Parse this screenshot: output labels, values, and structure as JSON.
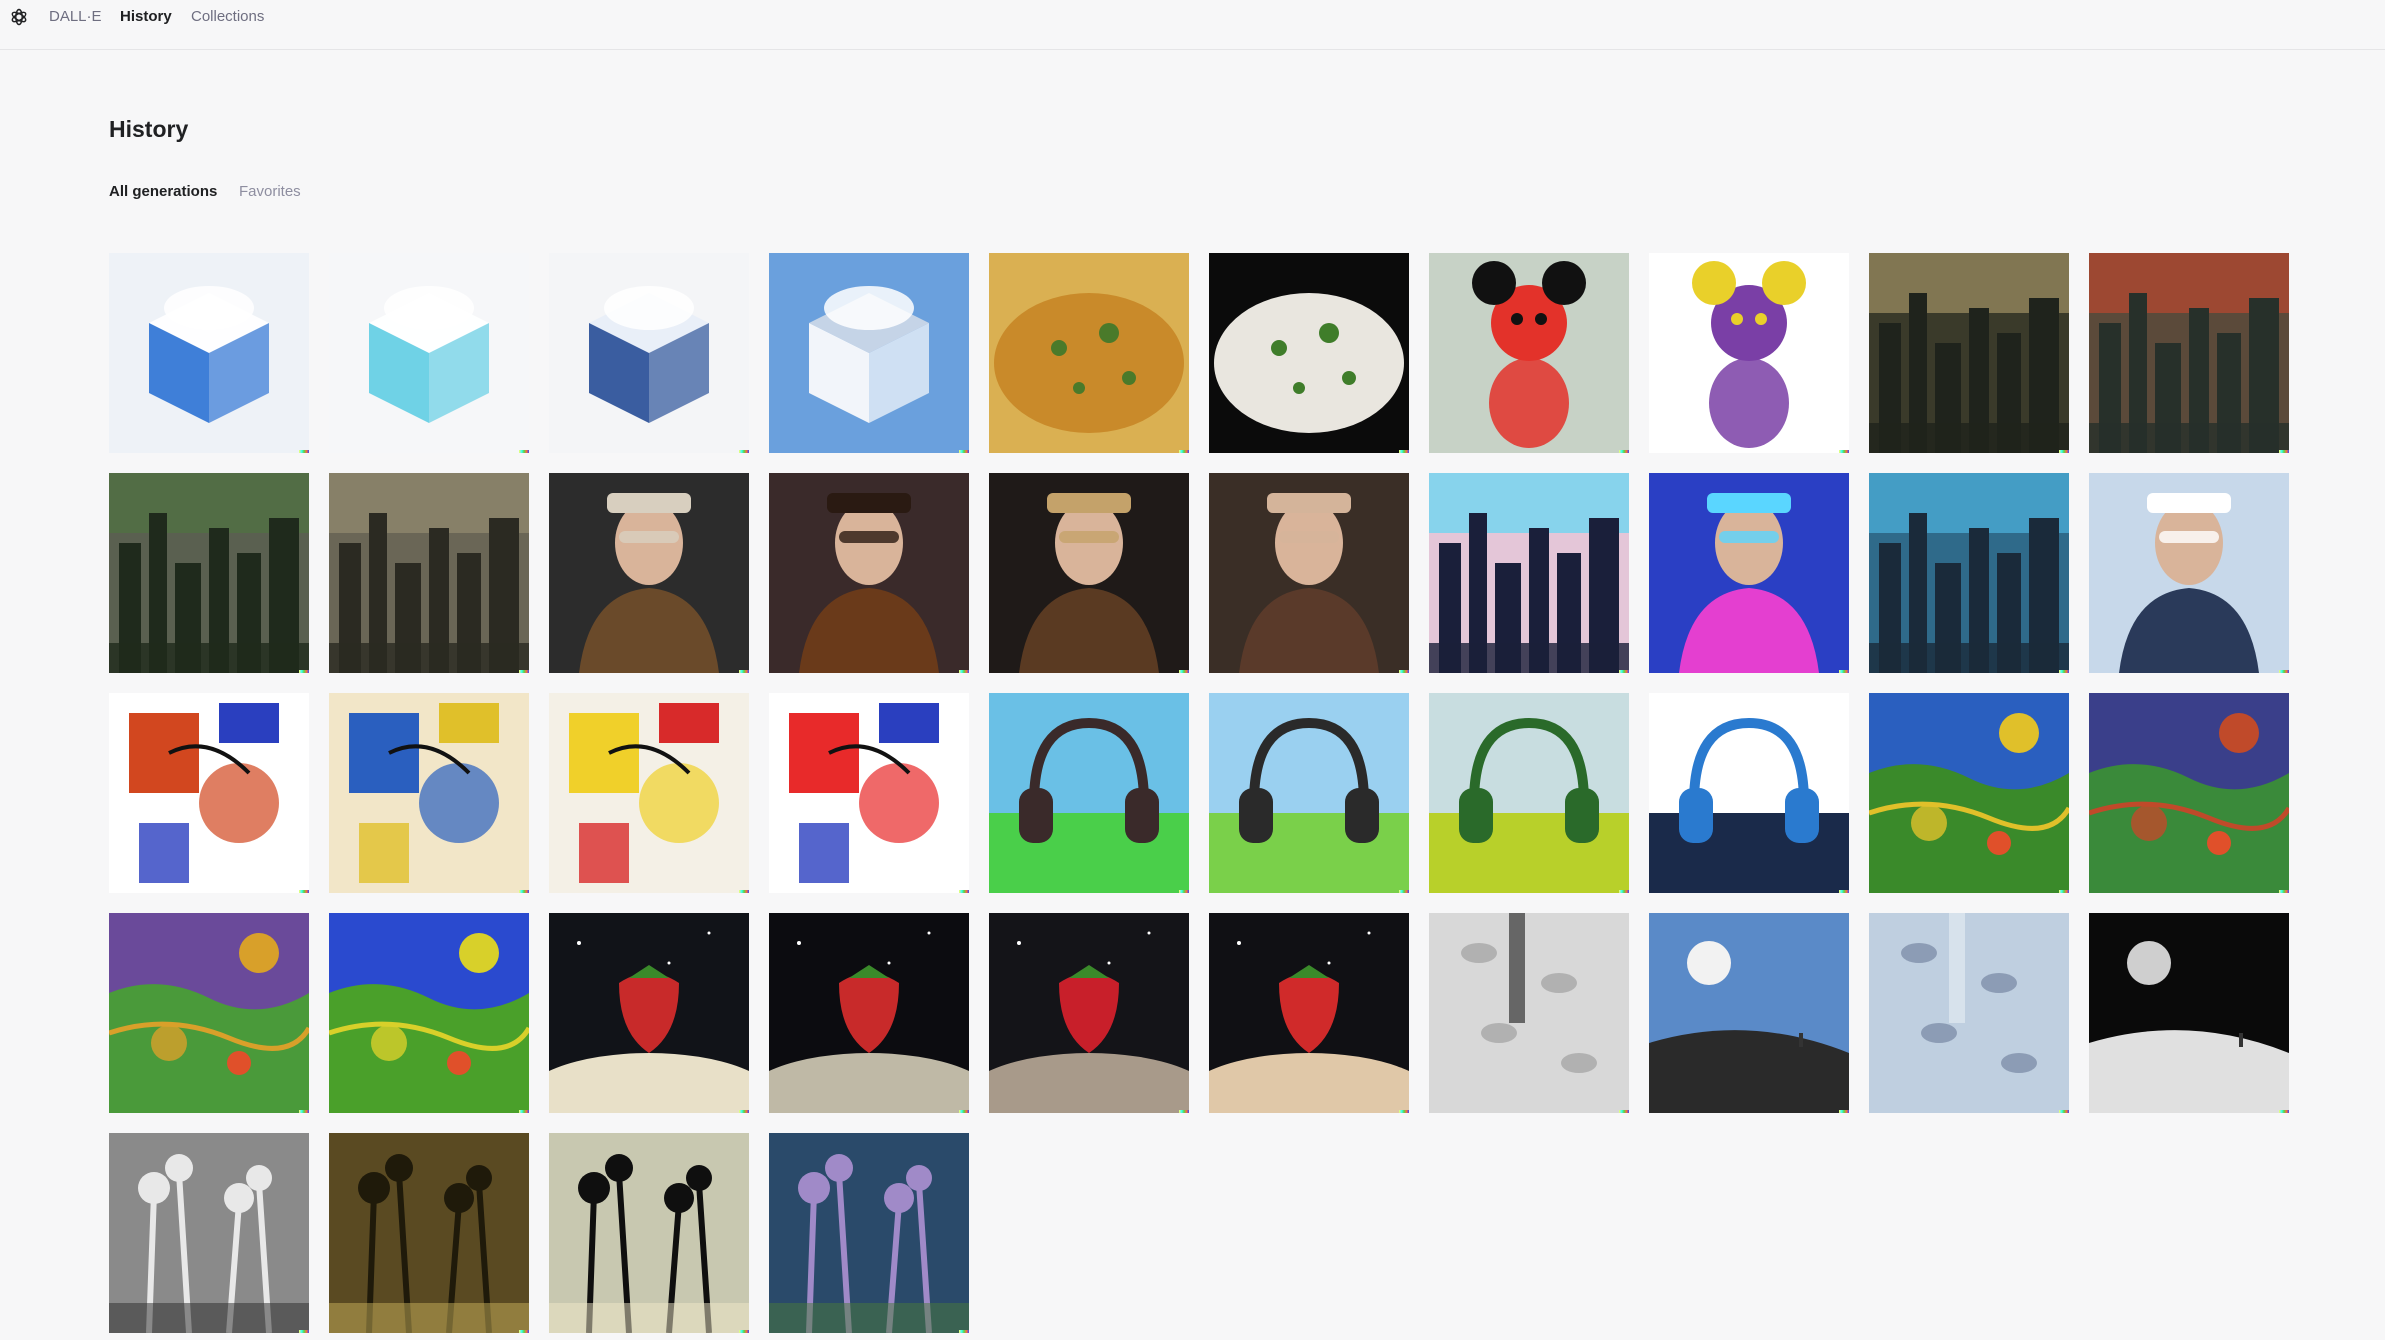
{
  "app": {
    "logo_icon": "openai-logo-icon",
    "nav": [
      {
        "label": "DALL·E",
        "active": false
      },
      {
        "label": "History",
        "active": true
      },
      {
        "label": "Collections",
        "active": false
      }
    ]
  },
  "page": {
    "title": "History",
    "tabs": [
      {
        "label": "All generations",
        "active": true
      },
      {
        "label": "Favorites",
        "active": false
      }
    ]
  },
  "images": [
    {
      "subject": "cloud-in-glass-cube",
      "bg": "#eef2f7",
      "fg": "#3f7fd8",
      "accent": "#ffffff",
      "shape": "cube"
    },
    {
      "subject": "cloud-cube-cyan",
      "bg": "#f6f7f9",
      "fg": "#6fd2e6",
      "accent": "#ffffff",
      "shape": "cube"
    },
    {
      "subject": "cube-with-clouds",
      "bg": "#f4f5f7",
      "fg": "#3a5da0",
      "accent": "#e8eef7",
      "shape": "cube"
    },
    {
      "subject": "white-cloud-cube-sky",
      "bg": "#6aa0dd",
      "fg": "#f2f5fa",
      "accent": "#cfd9e8",
      "shape": "cube"
    },
    {
      "subject": "soup-bowl",
      "bg": "#dab052",
      "fg": "#c98a2a",
      "accent": "#4a7a2a",
      "shape": "food"
    },
    {
      "subject": "dish-with-herbs",
      "bg": "#0b0b0b",
      "fg": "#e9e6df",
      "accent": "#3f7d2a",
      "shape": "food"
    },
    {
      "subject": "mouse-face-decoration",
      "bg": "#c7d2c6",
      "fg": "#e3322a",
      "accent": "#111111",
      "shape": "figure"
    },
    {
      "subject": "cartoon-character-3d",
      "bg": "#ffffff",
      "fg": "#7a3fa6",
      "accent": "#e9d02a",
      "shape": "figure"
    },
    {
      "subject": "ruined-city-dusk",
      "bg": "#3a3a2a",
      "fg": "#1f231c",
      "accent": "#c7b27a",
      "shape": "city"
    },
    {
      "subject": "ruined-city-sunset",
      "bg": "#5b4a3a",
      "fg": "#27302a",
      "accent": "#e0462a",
      "shape": "city"
    },
    {
      "subject": "alien-city-plants",
      "bg": "#5a6050",
      "fg": "#1f2a1c",
      "accent": "#4a7a3a",
      "shape": "city"
    },
    {
      "subject": "dark-ruined-city",
      "bg": "#6a6656",
      "fg": "#2b2a22",
      "accent": "#a39a7a",
      "shape": "city"
    },
    {
      "subject": "steampunk-woman-hat",
      "bg": "#2c2c2c",
      "fg": "#6a4a2a",
      "accent": "#d8cfbf",
      "shape": "portrait"
    },
    {
      "subject": "steampunk-woman-goggles",
      "bg": "#3a2a2a",
      "fg": "#6a3a1a",
      "accent": "#2a1a12",
      "shape": "portrait"
    },
    {
      "subject": "steampunk-man",
      "bg": "#1f1a18",
      "fg": "#5a3a22",
      "accent": "#c4a26a",
      "shape": "portrait"
    },
    {
      "subject": "steampunk-woman-tophat",
      "bg": "#3a2e26",
      "fg": "#5a3a2a",
      "accent": "#d4b49a",
      "shape": "portrait"
    },
    {
      "subject": "cyberpunk-city-neon",
      "bg": "#e4c6d8",
      "fg": "#1a1f3a",
      "accent": "#2ae0ff",
      "shape": "city"
    },
    {
      "subject": "cyberpunk-woman-visor",
      "bg": "#2a3fc4",
      "fg": "#e43fd0",
      "accent": "#5ad6ff",
      "shape": "portrait"
    },
    {
      "subject": "cyberpunk-street-rider",
      "bg": "#2f6a8a",
      "fg": "#1a2a3a",
      "accent": "#5ad0ff",
      "shape": "city"
    },
    {
      "subject": "cyborg-woman-city",
      "bg": "#c7d8ea",
      "fg": "#2a3a5a",
      "accent": "#ffffff",
      "shape": "portrait"
    },
    {
      "subject": "abstract-face-line-art",
      "bg": "#ffffff",
      "fg": "#d2471f",
      "accent": "#2a3fbf",
      "shape": "abstract"
    },
    {
      "subject": "cubist-face-colors",
      "bg": "#f2e6c8",
      "fg": "#2a5fbf",
      "accent": "#e0c02a",
      "shape": "abstract"
    },
    {
      "subject": "abstract-faces-red-yellow",
      "bg": "#f4f0e6",
      "fg": "#f0d02a",
      "accent": "#d82a2a",
      "shape": "abstract"
    },
    {
      "subject": "abstract-two-faces",
      "bg": "#ffffff",
      "fg": "#e82a2a",
      "accent": "#2a3fbf",
      "shape": "abstract"
    },
    {
      "subject": "headset-painting",
      "bg": "#6ac0e6",
      "fg": "#3a2a2a",
      "accent": "#4acf4a",
      "shape": "headset"
    },
    {
      "subject": "headset-sketch-field",
      "bg": "#9ad0f0",
      "fg": "#2a2a2a",
      "accent": "#7ad04a",
      "shape": "headset"
    },
    {
      "subject": "headset-in-field",
      "bg": "#c8dde0",
      "fg": "#2a6a2a",
      "accent": "#b8d02a",
      "shape": "headset"
    },
    {
      "subject": "blue-headset-sketch",
      "bg": "#ffffff",
      "fg": "#2a7acf",
      "accent": "#1a2a4a",
      "shape": "headset"
    },
    {
      "subject": "van-gogh-field-kids",
      "bg": "#2a5fbf",
      "fg": "#e0c02a",
      "accent": "#3a8a2a",
      "shape": "painting"
    },
    {
      "subject": "van-gogh-night-figure",
      "bg": "#3a3f8a",
      "fg": "#c04a2a",
      "accent": "#3a8a3a",
      "shape": "painting"
    },
    {
      "subject": "impressionist-garden",
      "bg": "#6a4a9a",
      "fg": "#d8a02a",
      "accent": "#4a9a3a",
      "shape": "painting"
    },
    {
      "subject": "impressionist-river",
      "bg": "#2a4acf",
      "fg": "#d8d02a",
      "accent": "#4aa02a",
      "shape": "painting"
    },
    {
      "subject": "strawberry-moon-walker",
      "bg": "#111318",
      "fg": "#c82a2a",
      "accent": "#e8e0c8",
      "shape": "strawberry"
    },
    {
      "subject": "strawberry-on-moon",
      "bg": "#0c0c10",
      "fg": "#c82a2a",
      "accent": "#bfb9a6",
      "shape": "strawberry"
    },
    {
      "subject": "strawberry-giant-walker",
      "bg": "#141418",
      "fg": "#c81f2a",
      "accent": "#a89a8a",
      "shape": "strawberry"
    },
    {
      "subject": "strawberry-space-walker",
      "bg": "#101014",
      "fg": "#d02a2a",
      "accent": "#e0c8a8",
      "shape": "strawberry"
    },
    {
      "subject": "footprints-in-snow",
      "bg": "#d8d8d8",
      "fg": "#8a8a8a",
      "accent": "#1a1a1a",
      "shape": "snow"
    },
    {
      "subject": "moon-over-hill-walker",
      "bg": "#5a8ac8",
      "fg": "#2a2a2a",
      "accent": "#f2f2f2",
      "shape": "moonscape"
    },
    {
      "subject": "feet-on-ice",
      "bg": "#bfcfe0",
      "fg": "#5a6a8a",
      "accent": "#e8eef4",
      "shape": "snow"
    },
    {
      "subject": "moon-walker-footprints",
      "bg": "#0a0a0a",
      "fg": "#e0e0e0",
      "accent": "#cfcfcf",
      "shape": "moonscape"
    },
    {
      "subject": "black-white-plants",
      "bg": "#8a8a8a",
      "fg": "#e8e8e8",
      "accent": "#2a2a2a",
      "shape": "plants"
    },
    {
      "subject": "sepia-jungle-scene",
      "bg": "#5a4a22",
      "fg": "#1f1a0a",
      "accent": "#c8b05a",
      "shape": "plants"
    },
    {
      "subject": "plant-silhouettes-sky",
      "bg": "#c8c8b0",
      "fg": "#0f0f0f",
      "accent": "#f0e8c8",
      "shape": "plants"
    },
    {
      "subject": "thistle-flowers-blue",
      "bg": "#2a4a6a",
      "fg": "#a08ac8",
      "accent": "#4a7a3a",
      "shape": "plants"
    }
  ]
}
